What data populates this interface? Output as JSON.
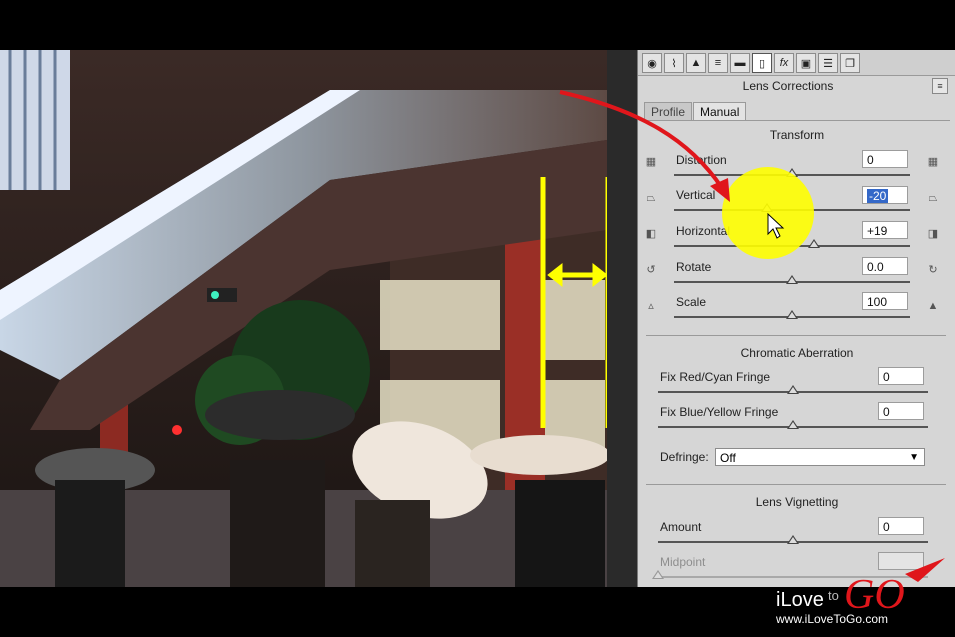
{
  "toolbar": {
    "icons": [
      "aperture-icon",
      "tone-curve-icon",
      "detail-icon",
      "hsl-icon",
      "split-toning-icon",
      "lens-corrections-icon",
      "fx-icon",
      "camera-calibration-icon",
      "presets-icon",
      "snapshots-icon"
    ],
    "fx_label": "fx"
  },
  "panel": {
    "title": "Lens Corrections",
    "tabs": [
      {
        "label": "Profile"
      },
      {
        "label": "Manual"
      }
    ]
  },
  "transform": {
    "title": "Transform",
    "distortion": {
      "label": "Distortion",
      "value": "0"
    },
    "vertical": {
      "label": "Vertical",
      "value": "-20"
    },
    "horizontal": {
      "label": "Horizontal",
      "value": "+19"
    },
    "rotate": {
      "label": "Rotate",
      "value": "0.0"
    },
    "scale": {
      "label": "Scale",
      "value": "100"
    }
  },
  "chromatic": {
    "title": "Chromatic Aberration",
    "red_cyan": {
      "label": "Fix Red/Cyan Fringe",
      "value": "0"
    },
    "blue_yellow": {
      "label": "Fix Blue/Yellow Fringe",
      "value": "0"
    },
    "defringe_label": "Defringe:",
    "defringe_value": "Off"
  },
  "vignetting": {
    "title": "Lens Vignetting",
    "amount": {
      "label": "Amount",
      "value": "0"
    },
    "midpoint": {
      "label": "Midpoint",
      "value": ""
    }
  },
  "branding": {
    "logo_text": "iLoveToGO",
    "url": "www.iLoveToGo.com"
  },
  "colors": {
    "annotation_red": "#e0161b",
    "highlight_yellow": "#ffff00"
  }
}
